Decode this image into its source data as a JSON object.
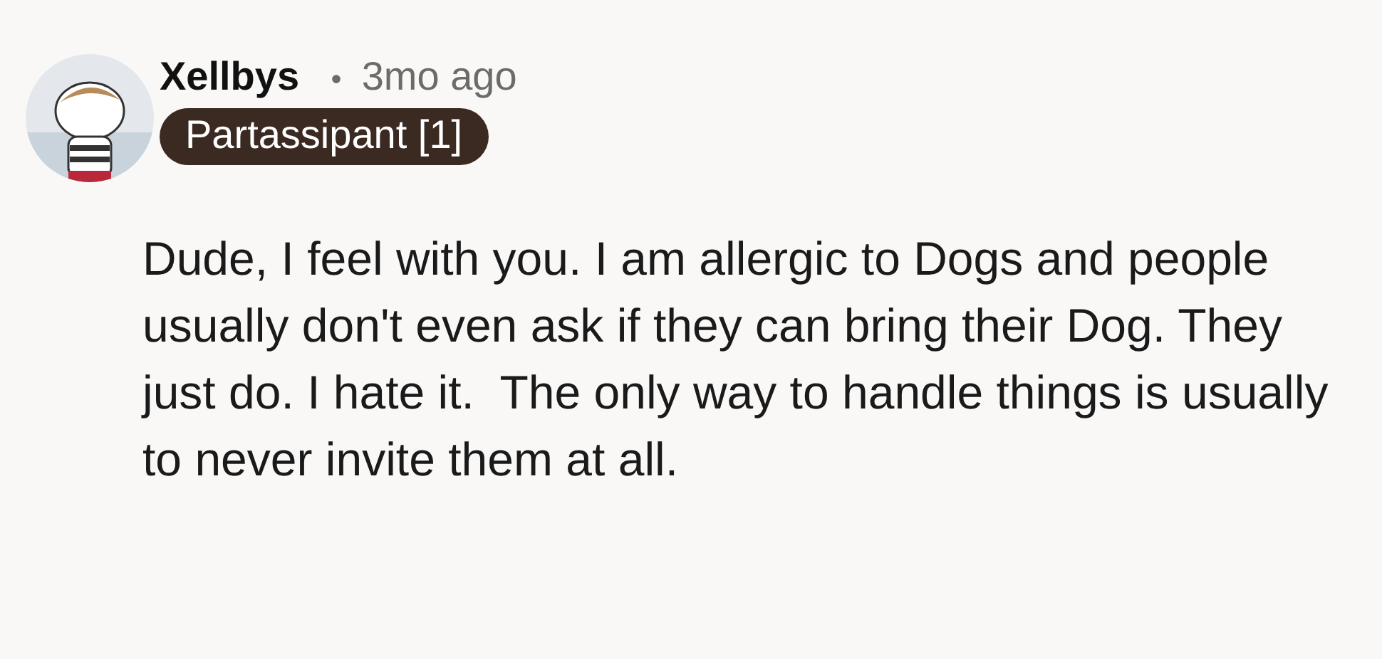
{
  "comment": {
    "author": "Xellbys",
    "separator": "•",
    "time": "3mo ago",
    "flair": "Partassipant [1]",
    "body": "Dude, I feel with you. I am allergic to Dogs and people usually don't even ask if they can bring their Dog. They just do. I hate it.  The only way to handle things is usually to never invite them at all."
  }
}
